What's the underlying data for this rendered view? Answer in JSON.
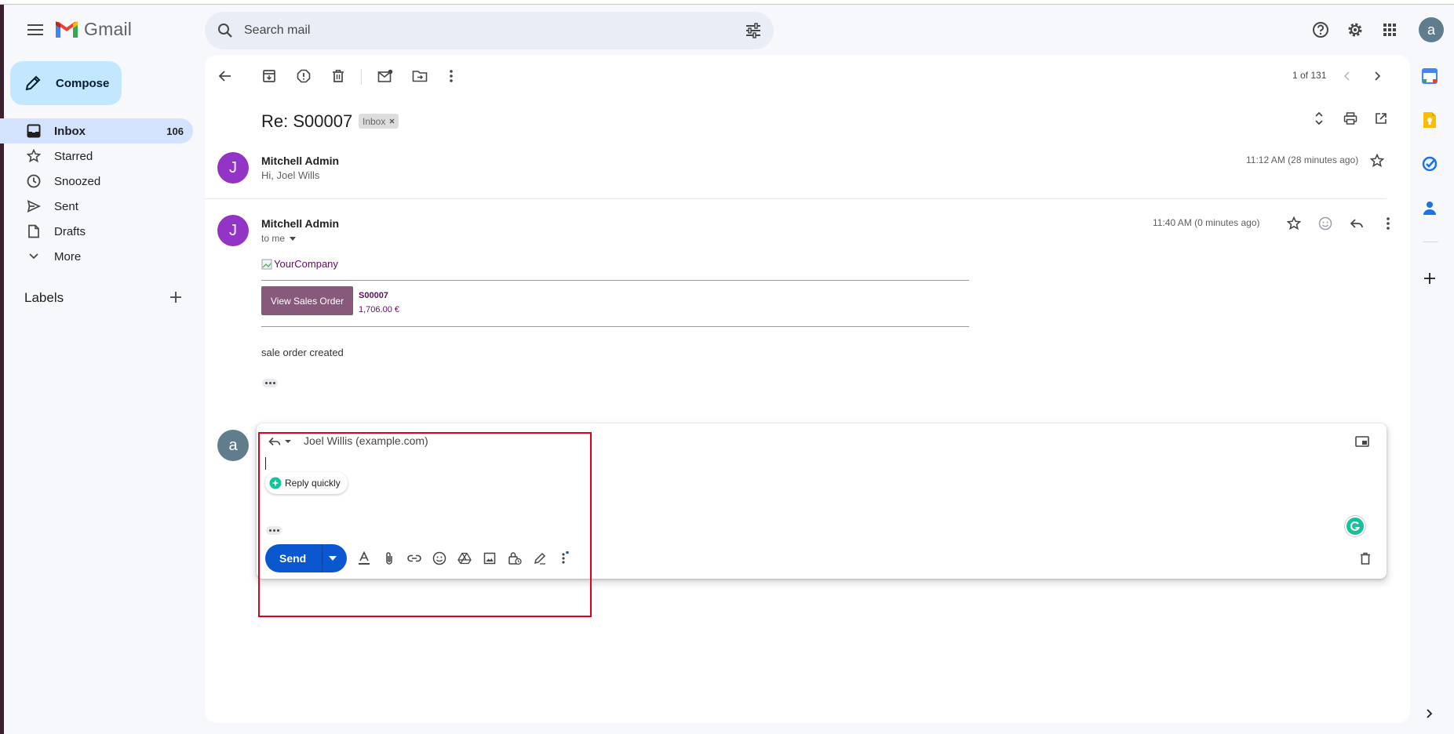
{
  "app": {
    "name": "Gmail"
  },
  "search": {
    "placeholder": "Search mail"
  },
  "profile": {
    "initial": "a"
  },
  "compose": {
    "label": "Compose"
  },
  "sidebar": {
    "items": [
      {
        "label": "Inbox",
        "count": "106",
        "icon": "inbox-icon"
      },
      {
        "label": "Starred",
        "icon": "star-icon"
      },
      {
        "label": "Snoozed",
        "icon": "clock-icon"
      },
      {
        "label": "Sent",
        "icon": "send-icon"
      },
      {
        "label": "Drafts",
        "icon": "draft-icon"
      },
      {
        "label": "More",
        "icon": "chevron-down-icon"
      }
    ],
    "labels_title": "Labels"
  },
  "toolbar": {
    "pager": "1 of 131"
  },
  "thread": {
    "subject": "Re: S00007",
    "label_chip": "Inbox",
    "messages": [
      {
        "avatar": "J",
        "sender": "Mitchell Admin",
        "snippet": "Hi, Joel Wills",
        "time": "11:12 AM (28 minutes ago)"
      },
      {
        "avatar": "J",
        "sender": "Mitchell Admin",
        "to": "to me",
        "time": "11:40 AM (0 minutes ago)",
        "company": "YourCompany",
        "button": "View Sales Order",
        "order_ref": "S00007",
        "order_amount": "1,706.00 €",
        "body": "sale order created"
      }
    ]
  },
  "reply": {
    "avatar": "a",
    "recipient": "Joel Willis (example.com)",
    "quick_reply": "Reply quickly",
    "send_label": "Send"
  },
  "colors": {
    "accent": "#0b57d0",
    "compose_bg": "#c2e7ff",
    "active_nav": "#d3e3fd",
    "avatar_purple": "#9334c7",
    "odoo_button": "#875a7b",
    "highlight": "#e0001b"
  }
}
